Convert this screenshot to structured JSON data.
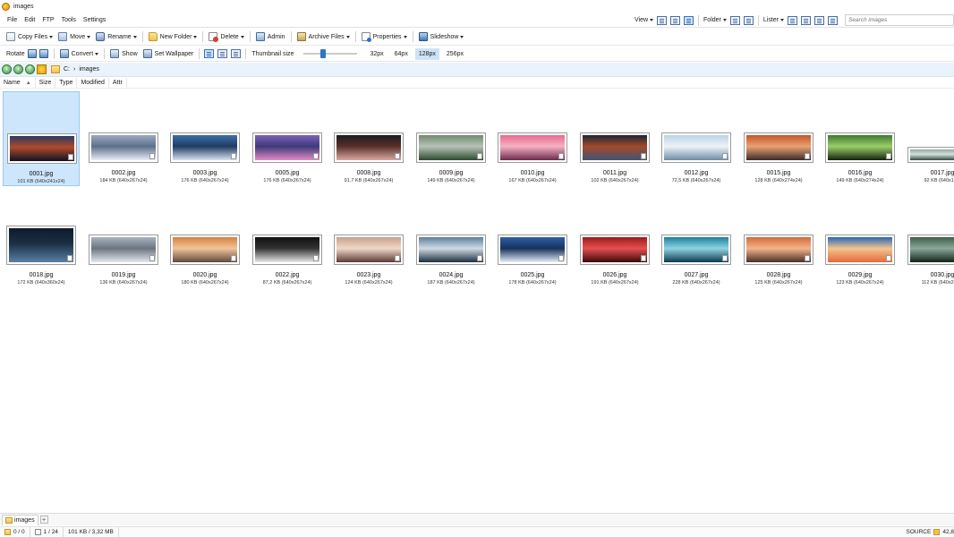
{
  "window": {
    "title": "images"
  },
  "menu": {
    "items": [
      "File",
      "Edit",
      "FTP",
      "Tools",
      "Settings"
    ]
  },
  "menubar_right": {
    "view_label": "View",
    "folder_label": "Folder",
    "lister_label": "Lister",
    "search_placeholder": "Search images"
  },
  "toolbar1": {
    "copy_files": "Copy Files",
    "move": "Move",
    "rename": "Rename",
    "new_folder": "New Folder",
    "delete": "Delete",
    "admin": "Admin",
    "archive_files": "Archive Files",
    "properties": "Properties",
    "slideshow": "Slideshow"
  },
  "toolbar2": {
    "rotate": "Rotate",
    "convert": "Convert",
    "show": "Show",
    "set_wallpaper": "Set Wallpaper",
    "thumbnail_size_label": "Thumbnail size",
    "sizes": [
      "32px",
      "64px",
      "128px",
      "256px"
    ],
    "active_size": "128px"
  },
  "address": {
    "drive": "C:",
    "sep": "›",
    "folder": "images"
  },
  "columns": [
    "Name",
    "Size",
    "Type",
    "Modified",
    "Attr"
  ],
  "files": [
    {
      "name": "0001.jpg",
      "meta": "101 KB (640x241x24)",
      "colors": [
        "#2b3a63",
        "#0c1224",
        "#b14a2a"
      ],
      "selected": true
    },
    {
      "name": "0002.jpg",
      "meta": "184 KB (640x267x24)",
      "colors": [
        "#9aa9c0",
        "#e9eef5",
        "#5c6f8a"
      ]
    },
    {
      "name": "0003.jpg",
      "meta": "176 KB (640x267x24)",
      "colors": [
        "#3d6fa8",
        "#d7e4ef",
        "#1f3c63"
      ]
    },
    {
      "name": "0005.jpg",
      "meta": "176 KB (640x267x24)",
      "colors": [
        "#7e62b8",
        "#e38bc3",
        "#3d3a7a"
      ]
    },
    {
      "name": "0008.jpg",
      "meta": "91,7 KB (640x267x24)",
      "colors": [
        "#1b1b1f",
        "#d9a9a2",
        "#5a2f2a"
      ]
    },
    {
      "name": "0009.jpg",
      "meta": "149 KB (640x267x24)",
      "colors": [
        "#6f8a6e",
        "#2d4a2f",
        "#b9c2b9"
      ]
    },
    {
      "name": "0010.jpg",
      "meta": "167 KB (640x267x24)",
      "colors": [
        "#e86a8d",
        "#6b2a4a",
        "#f6b1c3"
      ]
    },
    {
      "name": "0011.jpg",
      "meta": "102 KB (640x267x24)",
      "colors": [
        "#1c2536",
        "#3e5574",
        "#a34a2a"
      ]
    },
    {
      "name": "0012.jpg",
      "meta": "72,5 KB (640x267x24)",
      "colors": [
        "#bcd3e6",
        "#6d8ba6",
        "#eef3f7"
      ]
    },
    {
      "name": "0015.jpg",
      "meta": "128 KB (640x274x24)",
      "colors": [
        "#c4552c",
        "#3a2a2b",
        "#e9a272"
      ]
    },
    {
      "name": "0016.jpg",
      "meta": "149 KB (640x274x24)",
      "colors": [
        "#3d7a2e",
        "#11220d",
        "#9ccd6a"
      ]
    },
    {
      "name": "0017.jpg",
      "meta": "92 KB (640x12...",
      "colors": [
        "#8ea8a0",
        "#2f4a40",
        "#d5e0dc"
      ]
    },
    {
      "name": "0018.jpg",
      "meta": "172 KB (640x360x24)",
      "colors": [
        "#0f1b2c",
        "#5a7fa3",
        "#1b2f45"
      ]
    },
    {
      "name": "0019.jpg",
      "meta": "136 KB (640x267x24)",
      "colors": [
        "#a9b4c0",
        "#e4e8ed",
        "#6b7480"
      ]
    },
    {
      "name": "0020.jpg",
      "meta": "180 KB (640x267x24)",
      "colors": [
        "#d6813d",
        "#5f4a3f",
        "#f0c49a"
      ]
    },
    {
      "name": "0022.jpg",
      "meta": "87,2 KB (640x267x24)",
      "colors": [
        "#111111",
        "#e8e8e8",
        "#333333"
      ]
    },
    {
      "name": "0023.jpg",
      "meta": "124 KB (640x267x24)",
      "colors": [
        "#c8a08c",
        "#5c3a34",
        "#efd8c8"
      ]
    },
    {
      "name": "0024.jpg",
      "meta": "187 KB (640x267x24)",
      "colors": [
        "#5c7f9c",
        "#1c2e3d",
        "#cfdbe4"
      ]
    },
    {
      "name": "0025.jpg",
      "meta": "178 KB (640x267x24)",
      "colors": [
        "#2f5fa6",
        "#e6eef7",
        "#16325b"
      ]
    },
    {
      "name": "0026.jpg",
      "meta": "191 KB (640x267x24)",
      "colors": [
        "#9b1c1c",
        "#3a0a0a",
        "#e45050"
      ]
    },
    {
      "name": "0027.jpg",
      "meta": "228 KB (640x267x24)",
      "colors": [
        "#1e7f9a",
        "#0c3a4d",
        "#8fd3e2"
      ]
    },
    {
      "name": "0028.jpg",
      "meta": "125 KB (640x267x24)",
      "colors": [
        "#d36b3b",
        "#4a2f2a",
        "#f3b489"
      ]
    },
    {
      "name": "0029.jpg",
      "meta": "123 KB (640x267x24)",
      "colors": [
        "#2a66b3",
        "#e46a3a",
        "#f2c58f"
      ]
    },
    {
      "name": "0030.jpg",
      "meta": "112 KB (640x267...",
      "colors": [
        "#3f5d4a",
        "#12231a",
        "#8aa79a"
      ]
    }
  ],
  "tabs": [
    {
      "label": "images"
    }
  ],
  "status": {
    "folders": "0 / 0",
    "files": "1 / 24",
    "size": "101 KB / 3,32 MB",
    "source": "SOURCE",
    "coord": "42,8"
  }
}
